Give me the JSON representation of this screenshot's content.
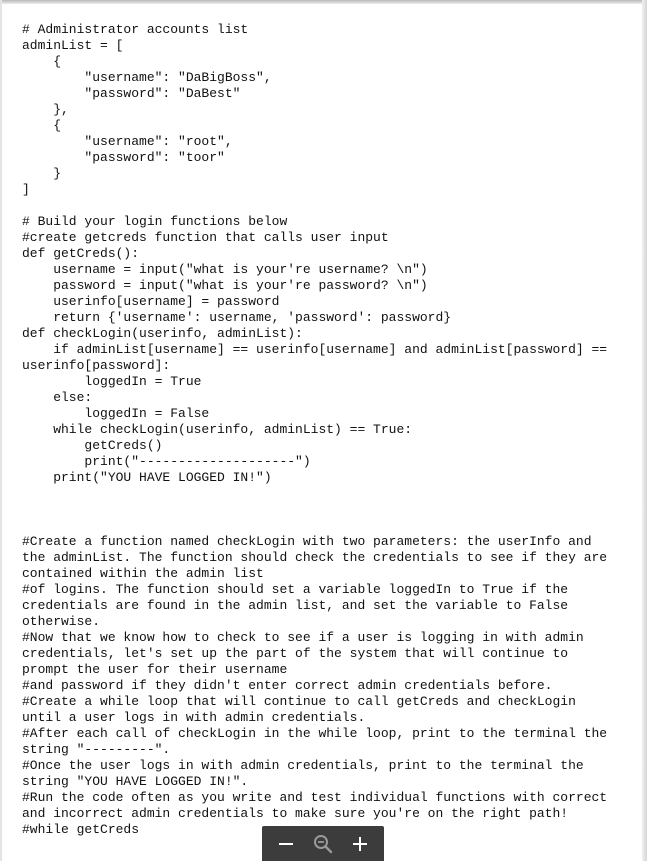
{
  "document": {
    "lines": [
      "# Administrator accounts list",
      "adminList = [",
      "    {",
      "        \"username\": \"DaBigBoss\",",
      "        \"password\": \"DaBest\"",
      "    },",
      "    {",
      "        \"username\": \"root\",",
      "        \"password\": \"toor\"",
      "    }",
      "]",
      "",
      "# Build your login functions below",
      "#create getcreds function that calls user input",
      "def getCreds():",
      "    username = input(\"what is your're username? \\n\")",
      "    password = input(\"what is your're password? \\n\")",
      "    userinfo[username] = password",
      "    return {'username': username, 'password': password}",
      "def checkLogin(userinfo, adminList):",
      "    if adminList[username] == userinfo[username] and adminList[password] ==",
      "userinfo[password]:",
      "        loggedIn = True",
      "    else:",
      "        loggedIn = False",
      "    while checkLogin(userinfo, adminList) == True:",
      "        getCreds()",
      "        print(\"--------------------\")",
      "    print(\"YOU HAVE LOGGED IN!\")",
      "",
      "",
      "",
      "#Create a function named checkLogin with two parameters: the userInfo and",
      "the adminList. The function should check the credentials to see if they are",
      "contained within the admin list",
      "#of logins. The function should set a variable loggedIn to True if the",
      "credentials are found in the admin list, and set the variable to False",
      "otherwise.",
      "#Now that we know how to check to see if a user is logging in with admin",
      "credentials, let's set up the part of the system that will continue to",
      "prompt the user for their username",
      "#and password if they didn't enter correct admin credentials before.",
      "#Create a while loop that will continue to call getCreds and checkLogin",
      "until a user logs in with admin credentials.",
      "#After each call of checkLogin in the while loop, print to the terminal the",
      "string \"---------\".",
      "#Once the user logs in with admin credentials, print to the terminal the",
      "string \"YOU HAVE LOGGED IN!\".",
      "#Run the code often as you write and test individual functions with correct",
      "and incorrect admin credentials to make sure you're on the right path!",
      "#while getCreds"
    ]
  },
  "toolbar": {
    "zoom_out_icon": "minus-icon",
    "zoom_reset_icon": "magnifier-minus-icon",
    "zoom_in_icon": "plus-icon"
  },
  "colors": {
    "text": "#111111",
    "toolbar_bg": "#3c3c3c",
    "toolbar_icon": "#ffffff",
    "toolbar_icon_muted": "#9a9a9a"
  }
}
